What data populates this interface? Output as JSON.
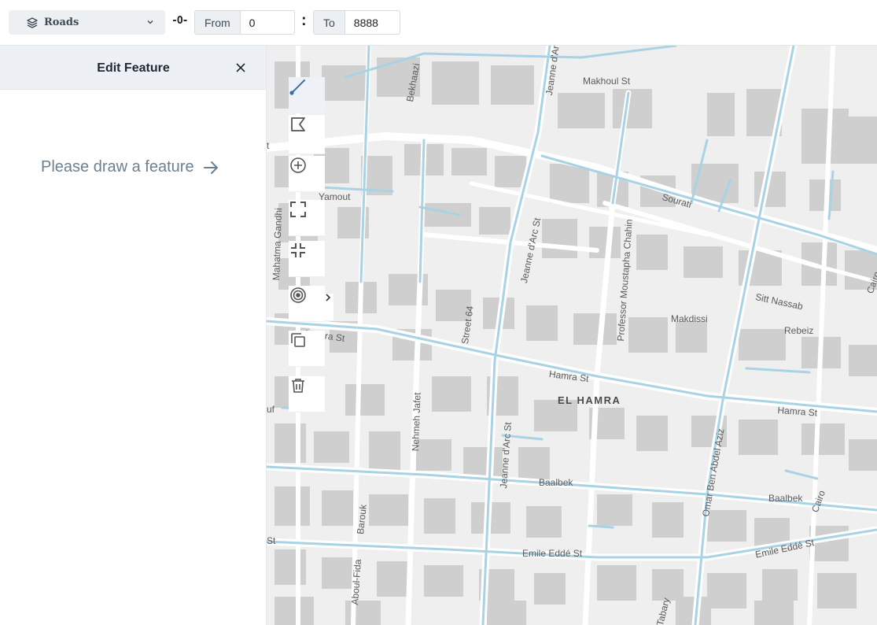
{
  "topbar": {
    "layer_select": {
      "label": "Roads",
      "icon": "layers-icon"
    },
    "link_glyph": "-O-",
    "from": {
      "label": "From",
      "value": "0"
    },
    "separator": ":",
    "to": {
      "label": "To",
      "value": "8888"
    }
  },
  "sidebar": {
    "title": "Edit Feature",
    "prompt": "Please draw a feature"
  },
  "map": {
    "labels": [
      "Makhoul St",
      "Bekhaazi",
      "Jeanne d'Arc",
      "Sourati",
      "Yamout",
      "Mahatma Gandhi",
      "Jeanne d'Arc St",
      "Professor Moustapha Chahin",
      "Sitt Nassab",
      "Cairo",
      "Makdissi",
      "Rebeiz",
      "Street 64",
      "Hamra St",
      "Hamra St",
      "Hamra St",
      "EL HAMRA",
      "Nehmeh Jafet",
      "Omar Ben Abdel Aziz",
      "Jeanne d'Arc St",
      "Baalbek",
      "Baalbek",
      "Cairo",
      "Barouk",
      "Emile Eddé St",
      "Emile Eddé St",
      "Aboul-Fida",
      "Tabary",
      "St",
      "uf",
      "t"
    ],
    "colors": {
      "background": "#efefef",
      "building": "#cfcfcf",
      "road": "#ffffff",
      "highlight": "#a9d3e4"
    }
  },
  "toolbar": {
    "tools": [
      {
        "name": "draw-line",
        "icon": "line-draw-icon",
        "active": true
      },
      {
        "name": "draw-polygon",
        "icon": "polygon-draw-icon",
        "active": false
      },
      {
        "name": "add-point",
        "icon": "plus-circle-icon",
        "active": false
      },
      {
        "name": "fullscreen",
        "icon": "expand-icon",
        "active": false
      },
      {
        "name": "exit-fullscreen",
        "icon": "compress-icon",
        "active": false
      },
      {
        "name": "target",
        "icon": "target-icon",
        "active": false
      },
      {
        "name": "duplicate",
        "icon": "copy-icon",
        "active": false
      },
      {
        "name": "delete",
        "icon": "trash-icon",
        "active": false
      }
    ]
  }
}
